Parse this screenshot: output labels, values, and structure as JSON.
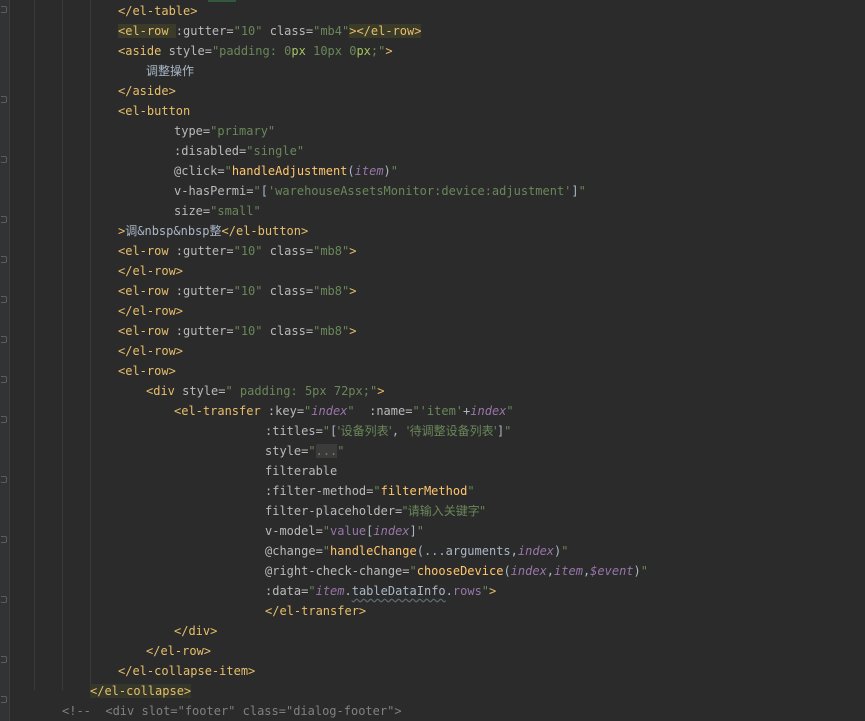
{
  "editor": {
    "language": "vue-template",
    "accent_colors": {
      "tag": "#e8bf6a",
      "attribute": "#bababa",
      "string": "#6a8759",
      "function": "#ffc66d",
      "variable": "#9876aa",
      "comment": "#808080",
      "background": "#2b2b2b"
    },
    "lines": [
      {
        "tokens": [
          {
            "t": "tag",
            "v": "</el-table>"
          }
        ]
      },
      {
        "tokens": [
          {
            "t": "tag",
            "v": "<el-row "
          },
          {
            "t": "attr",
            "v": ":gutter="
          },
          {
            "t": "str",
            "v": "\"10\""
          },
          {
            "t": "txt",
            "v": " "
          },
          {
            "t": "attr",
            "v": "class="
          },
          {
            "t": "str",
            "v": "\"mb4\""
          },
          {
            "t": "tag",
            "v": "></el-row>"
          }
        ]
      },
      {
        "tokens": [
          {
            "t": "tag",
            "v": "<aside "
          },
          {
            "t": "attr",
            "v": "style="
          },
          {
            "t": "str",
            "v": "\"padding: 0"
          },
          {
            "t": "bstr",
            "v": "px"
          },
          {
            "t": "str",
            "v": " 10px 0"
          },
          {
            "t": "bstr",
            "v": "px"
          },
          {
            "t": "str",
            "v": ";\""
          },
          {
            "t": "tag",
            "v": ">"
          }
        ]
      },
      {
        "tokens": [
          {
            "t": "txt",
            "v": "调整操作",
            "cjk": true
          }
        ]
      },
      {
        "tokens": [
          {
            "t": "tag",
            "v": "</aside>"
          }
        ]
      },
      {
        "tokens": [
          {
            "t": "tag",
            "v": "<el-button"
          }
        ]
      },
      {
        "tokens": [
          {
            "t": "attr",
            "v": "type="
          },
          {
            "t": "str",
            "v": "\"primary\""
          }
        ]
      },
      {
        "tokens": [
          {
            "t": "attr",
            "v": ":disabled="
          },
          {
            "t": "str",
            "v": "\"single\""
          }
        ]
      },
      {
        "tokens": [
          {
            "t": "attr",
            "v": "@click="
          },
          {
            "t": "str",
            "v": "\""
          },
          {
            "t": "fn",
            "v": "handleAdjustment"
          },
          {
            "t": "txt",
            "v": "("
          },
          {
            "t": "var",
            "v": "item"
          },
          {
            "t": "txt",
            "v": ")"
          },
          {
            "t": "str",
            "v": "\""
          }
        ]
      },
      {
        "tokens": [
          {
            "t": "attr",
            "v": "v-hasPermi="
          },
          {
            "t": "str",
            "v": "\""
          },
          {
            "t": "txt",
            "v": "["
          },
          {
            "t": "str",
            "v": "'warehouseAssetsMonitor:device:adjustment'"
          },
          {
            "t": "txt",
            "v": "]"
          },
          {
            "t": "str",
            "v": "\""
          }
        ]
      },
      {
        "tokens": [
          {
            "t": "attr",
            "v": "size="
          },
          {
            "t": "str",
            "v": "\"small\""
          }
        ]
      },
      {
        "tokens": [
          {
            "t": "tag",
            "v": ">"
          },
          {
            "t": "txt",
            "v": "调",
            "cjk": true
          },
          {
            "t": "txt",
            "v": "&nbsp&nbsp"
          },
          {
            "t": "txt",
            "v": "整",
            "cjk": true
          },
          {
            "t": "tag",
            "v": "</el-button>"
          }
        ]
      },
      {
        "tokens": [
          {
            "t": "tag",
            "v": "<el-row "
          },
          {
            "t": "attr",
            "v": ":gutter="
          },
          {
            "t": "str",
            "v": "\"10\""
          },
          {
            "t": "txt",
            "v": " "
          },
          {
            "t": "attr",
            "v": "class="
          },
          {
            "t": "str",
            "v": "\"mb8\""
          },
          {
            "t": "tag",
            "v": ">"
          }
        ]
      },
      {
        "tokens": [
          {
            "t": "tag",
            "v": "</el-row>"
          }
        ]
      },
      {
        "tokens": [
          {
            "t": "tag",
            "v": "<el-row "
          },
          {
            "t": "attr",
            "v": ":gutter="
          },
          {
            "t": "str",
            "v": "\"10\""
          },
          {
            "t": "txt",
            "v": " "
          },
          {
            "t": "attr",
            "v": "class="
          },
          {
            "t": "str",
            "v": "\"mb8\""
          },
          {
            "t": "tag",
            "v": ">"
          }
        ]
      },
      {
        "tokens": [
          {
            "t": "tag",
            "v": "</el-row>"
          }
        ]
      },
      {
        "tokens": [
          {
            "t": "tag",
            "v": "<el-row "
          },
          {
            "t": "attr",
            "v": ":gutter="
          },
          {
            "t": "str",
            "v": "\"10\""
          },
          {
            "t": "txt",
            "v": " "
          },
          {
            "t": "attr",
            "v": "class="
          },
          {
            "t": "str",
            "v": "\"mb8\""
          },
          {
            "t": "tag",
            "v": ">"
          }
        ]
      },
      {
        "tokens": [
          {
            "t": "tag",
            "v": "</el-row>"
          }
        ]
      },
      {
        "tokens": [
          {
            "t": "tag",
            "v": "<el-row>"
          }
        ]
      },
      {
        "tokens": [
          {
            "t": "tag",
            "v": "<div "
          },
          {
            "t": "attr",
            "v": "style="
          },
          {
            "t": "str",
            "v": "\" padding: 5px 72px;\""
          },
          {
            "t": "tag",
            "v": ">"
          }
        ]
      },
      {
        "tokens": [
          {
            "t": "tag",
            "v": "<el-transfer "
          },
          {
            "t": "attr",
            "v": ":key="
          },
          {
            "t": "str",
            "v": "\""
          },
          {
            "t": "var",
            "v": "index"
          },
          {
            "t": "str",
            "v": "\""
          },
          {
            "t": "txt",
            "v": "  "
          },
          {
            "t": "attr",
            "v": ":name="
          },
          {
            "t": "str",
            "v": "\"'item'"
          },
          {
            "t": "txt",
            "v": "+"
          },
          {
            "t": "var",
            "v": "index"
          },
          {
            "t": "str",
            "v": "\""
          }
        ]
      },
      {
        "tokens": [
          {
            "t": "attr",
            "v": ":titles="
          },
          {
            "t": "str",
            "v": "\""
          },
          {
            "t": "txt",
            "v": "["
          },
          {
            "t": "str",
            "v": "'设备列表'",
            "cjk": true
          },
          {
            "t": "txt",
            "v": ", "
          },
          {
            "t": "str",
            "v": "'待调整设备列表'",
            "cjk": true
          },
          {
            "t": "txt",
            "v": "]"
          },
          {
            "t": "str",
            "v": "\""
          }
        ]
      },
      {
        "tokens": [
          {
            "t": "attr",
            "v": "style="
          },
          {
            "t": "str",
            "v": "\""
          },
          {
            "t": "str",
            "v": "...",
            "box": true
          },
          {
            "t": "str",
            "v": "\""
          }
        ]
      },
      {
        "tokens": [
          {
            "t": "attr",
            "v": "filterable"
          }
        ]
      },
      {
        "tokens": [
          {
            "t": "attr",
            "v": ":filter-method="
          },
          {
            "t": "str",
            "v": "\""
          },
          {
            "t": "fn",
            "v": "filterMethod"
          },
          {
            "t": "str",
            "v": "\""
          }
        ]
      },
      {
        "tokens": [
          {
            "t": "attr",
            "v": "filter-placeholder="
          },
          {
            "t": "str",
            "v": "\"请输入关键字\"",
            "cjk": true
          }
        ]
      },
      {
        "tokens": [
          {
            "t": "attr",
            "v": "v-model="
          },
          {
            "t": "str",
            "v": "\""
          },
          {
            "t": "prop",
            "v": "value"
          },
          {
            "t": "txt",
            "v": "["
          },
          {
            "t": "var",
            "v": "index"
          },
          {
            "t": "txt",
            "v": "]"
          },
          {
            "t": "str",
            "v": "\""
          }
        ]
      },
      {
        "tokens": [
          {
            "t": "attr",
            "v": "@change="
          },
          {
            "t": "str",
            "v": "\""
          },
          {
            "t": "fn",
            "v": "handleChange"
          },
          {
            "t": "txt",
            "v": "(...arguments,"
          },
          {
            "t": "var",
            "v": "index"
          },
          {
            "t": "txt",
            "v": ")"
          },
          {
            "t": "str",
            "v": "\""
          }
        ]
      },
      {
        "tokens": [
          {
            "t": "attr",
            "v": "@right-check-change="
          },
          {
            "t": "str",
            "v": "\""
          },
          {
            "t": "fn",
            "v": "chooseDevice"
          },
          {
            "t": "txt",
            "v": "("
          },
          {
            "t": "var",
            "v": "index"
          },
          {
            "t": "txt",
            "v": ","
          },
          {
            "t": "var",
            "v": "item"
          },
          {
            "t": "txt",
            "v": ","
          },
          {
            "t": "var",
            "v": "$event"
          },
          {
            "t": "txt",
            "v": ")"
          },
          {
            "t": "str",
            "v": "\""
          }
        ]
      },
      {
        "tokens": [
          {
            "t": "attr",
            "v": ":data="
          },
          {
            "t": "str",
            "v": "\""
          },
          {
            "t": "var",
            "v": "item"
          },
          {
            "t": "txt",
            "v": "."
          },
          {
            "t": "txt",
            "v": "tableDataInfo",
            "wavy": true
          },
          {
            "t": "txt",
            "v": "."
          },
          {
            "t": "prop",
            "v": "rows"
          },
          {
            "t": "str",
            "v": "\""
          },
          {
            "t": "tag",
            "v": ">"
          }
        ]
      },
      {
        "tokens": [
          {
            "t": "tag",
            "v": "</el-transfer>"
          }
        ]
      },
      {
        "tokens": [
          {
            "t": "tag",
            "v": "</div>"
          }
        ]
      },
      {
        "tokens": [
          {
            "t": "tag",
            "v": "</el-row>"
          }
        ]
      },
      {
        "tokens": [
          {
            "t": "tag",
            "v": "</el-collapse-item>"
          }
        ]
      },
      {
        "tokens": [
          {
            "t": "tag",
            "v": "</el-collapse>"
          }
        ]
      },
      {
        "tokens": [
          {
            "t": "cmt",
            "v": "<!--  <div slot=\"footer\" class=\"dialog-footer\">"
          }
        ]
      }
    ]
  }
}
